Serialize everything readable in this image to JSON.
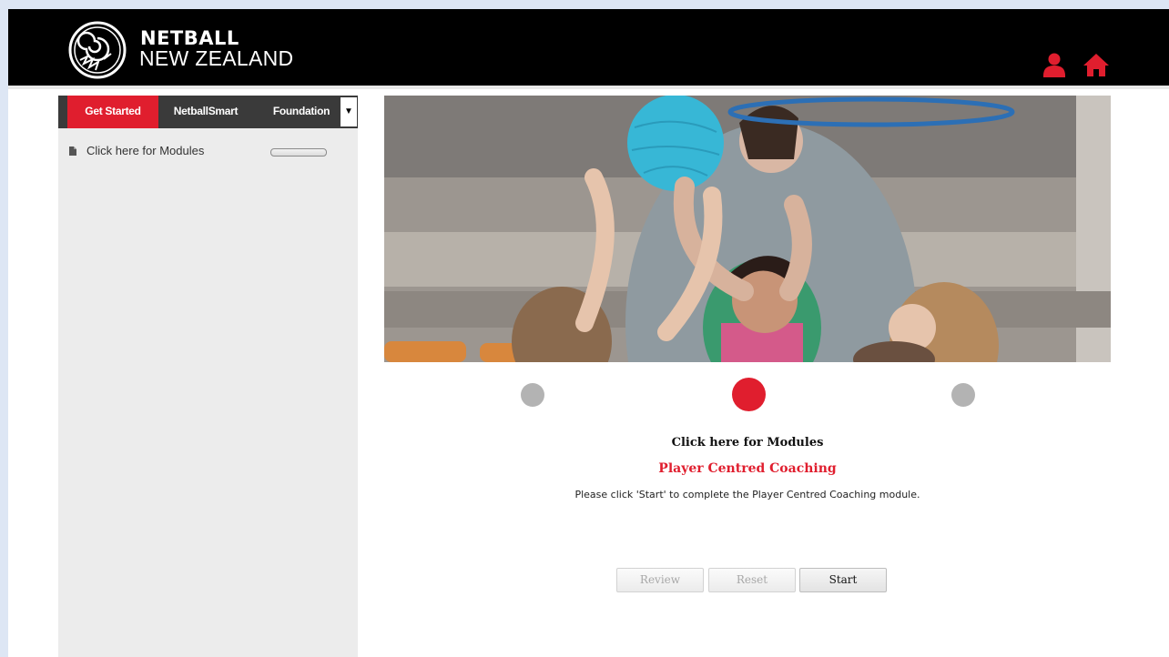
{
  "header": {
    "brand_line1": "NETBALL",
    "brand_line2": "NEW ZEALAND",
    "accent_color": "#e01e2e",
    "icons": [
      "user-icon",
      "home-icon"
    ]
  },
  "sidebar": {
    "tabs": [
      {
        "label": "Get Started",
        "active": true
      },
      {
        "label": "NetballSmart",
        "active": false
      },
      {
        "label": "Foundation",
        "active": false
      }
    ],
    "dropdown_glyph": "▼",
    "modules": [
      {
        "label": "Click here for Modules",
        "icon": "document-icon"
      }
    ]
  },
  "main": {
    "carousel": {
      "slide_count": 3,
      "active_index": 1
    },
    "module_title": "Click here for Modules",
    "module_subtitle": "Player Centred Coaching",
    "module_description": "Please click 'Start' to complete the Player Centred Coaching module.",
    "buttons": {
      "review": "Review",
      "reset": "Reset",
      "start": "Start"
    }
  }
}
